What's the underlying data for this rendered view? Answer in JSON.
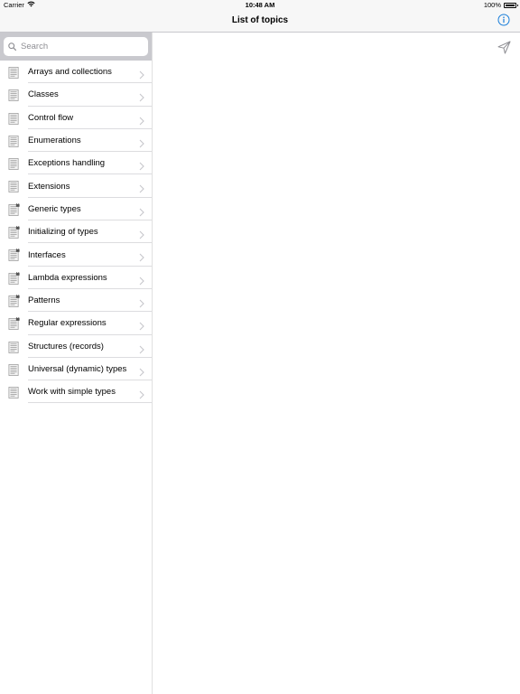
{
  "status_bar": {
    "carrier": "Carrier",
    "time": "10:48 AM",
    "battery_percent": "100%",
    "battery_level": 1.0,
    "wifi_icon": "wifi-icon"
  },
  "nav": {
    "title": "List of topics",
    "info_icon": "info-icon"
  },
  "search": {
    "placeholder": "Search",
    "value": ""
  },
  "topics": [
    {
      "label": "Arrays and collections",
      "locked": false
    },
    {
      "label": "Classes",
      "locked": false
    },
    {
      "label": "Control flow",
      "locked": false
    },
    {
      "label": "Enumerations",
      "locked": false
    },
    {
      "label": "Exceptions handling",
      "locked": false
    },
    {
      "label": "Extensions",
      "locked": false
    },
    {
      "label": "Generic types",
      "locked": true
    },
    {
      "label": "Initializing of types",
      "locked": true
    },
    {
      "label": "Interfaces",
      "locked": true
    },
    {
      "label": "Lambda expressions",
      "locked": true
    },
    {
      "label": "Patterns",
      "locked": true
    },
    {
      "label": "Regular expressions",
      "locked": true
    },
    {
      "label": "Structures (records)",
      "locked": false
    },
    {
      "label": "Universal (dynamic) types",
      "locked": false
    },
    {
      "label": "Work with simple types",
      "locked": false
    }
  ],
  "detail": {
    "send_icon": "send-icon"
  },
  "colors": {
    "accent": "#1a7ed9",
    "bar_background": "#f7f7f7",
    "search_bar_background": "#c9c9ce",
    "separator": "#dcdcdf",
    "icon_gray": "#8e8e93"
  }
}
